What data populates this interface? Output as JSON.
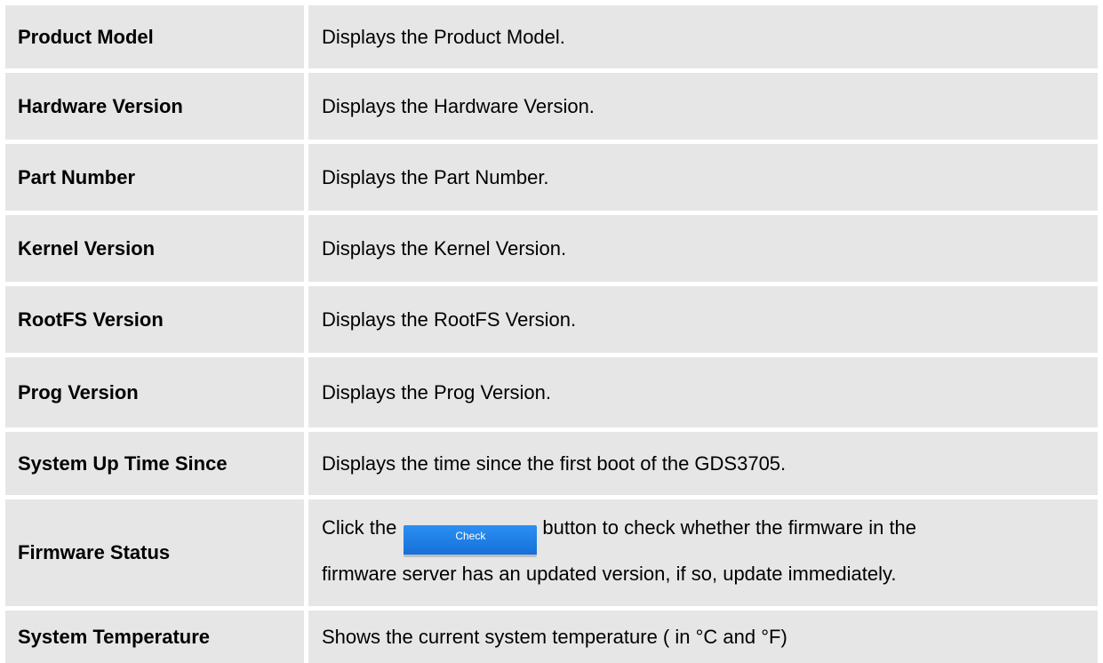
{
  "rows": [
    {
      "label": "Product Model",
      "description": "Displays the Product Model."
    },
    {
      "label": "Hardware Version",
      "description": "Displays the Hardware Version."
    },
    {
      "label": "Part Number",
      "description": "Displays the Part Number."
    },
    {
      "label": "Kernel Version",
      "description": "Displays the Kernel Version."
    },
    {
      "label": "RootFS Version",
      "description": "Displays the RootFS Version."
    },
    {
      "label": "Prog Version",
      "description": "Displays the Prog Version."
    },
    {
      "label": "System Up Time Since",
      "description": "Displays the time since the first boot of the GDS3705."
    },
    {
      "label": "Firmware Status",
      "description_prefix": "Click the",
      "button_label": "Check",
      "description_suffix": "button to check whether the firmware in the",
      "description_line2": "firmware server has an updated version, if so, update immediately."
    },
    {
      "label": "System Temperature",
      "description": "Shows the current system temperature ( in °C and °F)"
    }
  ],
  "colors": {
    "cell_background": "#e7e6e6",
    "button_background": "#1a7de6",
    "button_text": "#ffffff"
  }
}
